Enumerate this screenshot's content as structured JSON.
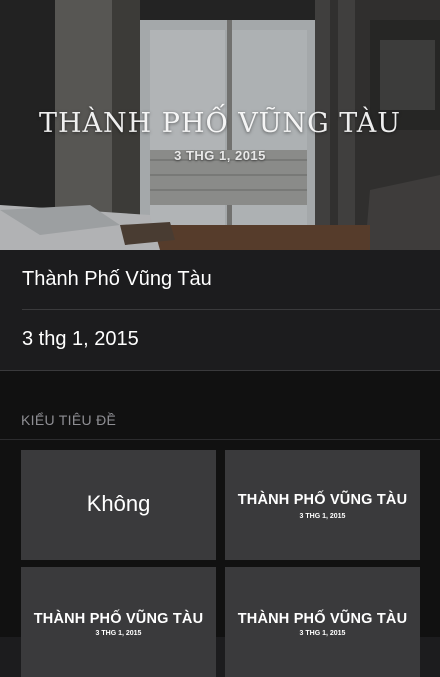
{
  "hero": {
    "title": "THÀNH PHỐ VŨNG TÀU",
    "date": "3 THG 1, 2015"
  },
  "fields": {
    "title_value": "Thành Phố Vũng Tàu",
    "date_value": "3 thg 1, 2015"
  },
  "title_styles": {
    "header": "KIỂU TIÊU ĐỀ",
    "none_label": "Không",
    "styles": [
      {
        "title": "THÀNH PHỐ VŨNG TÀU",
        "date": "3 THG 1, 2015"
      },
      {
        "title": "THÀNH PHỐ VŨNG TÀU",
        "date": "3 THG 1, 2015"
      },
      {
        "title": "THÀNH PHỐ VŨNG TÀU",
        "date": "3 THG 1, 2015"
      }
    ]
  }
}
